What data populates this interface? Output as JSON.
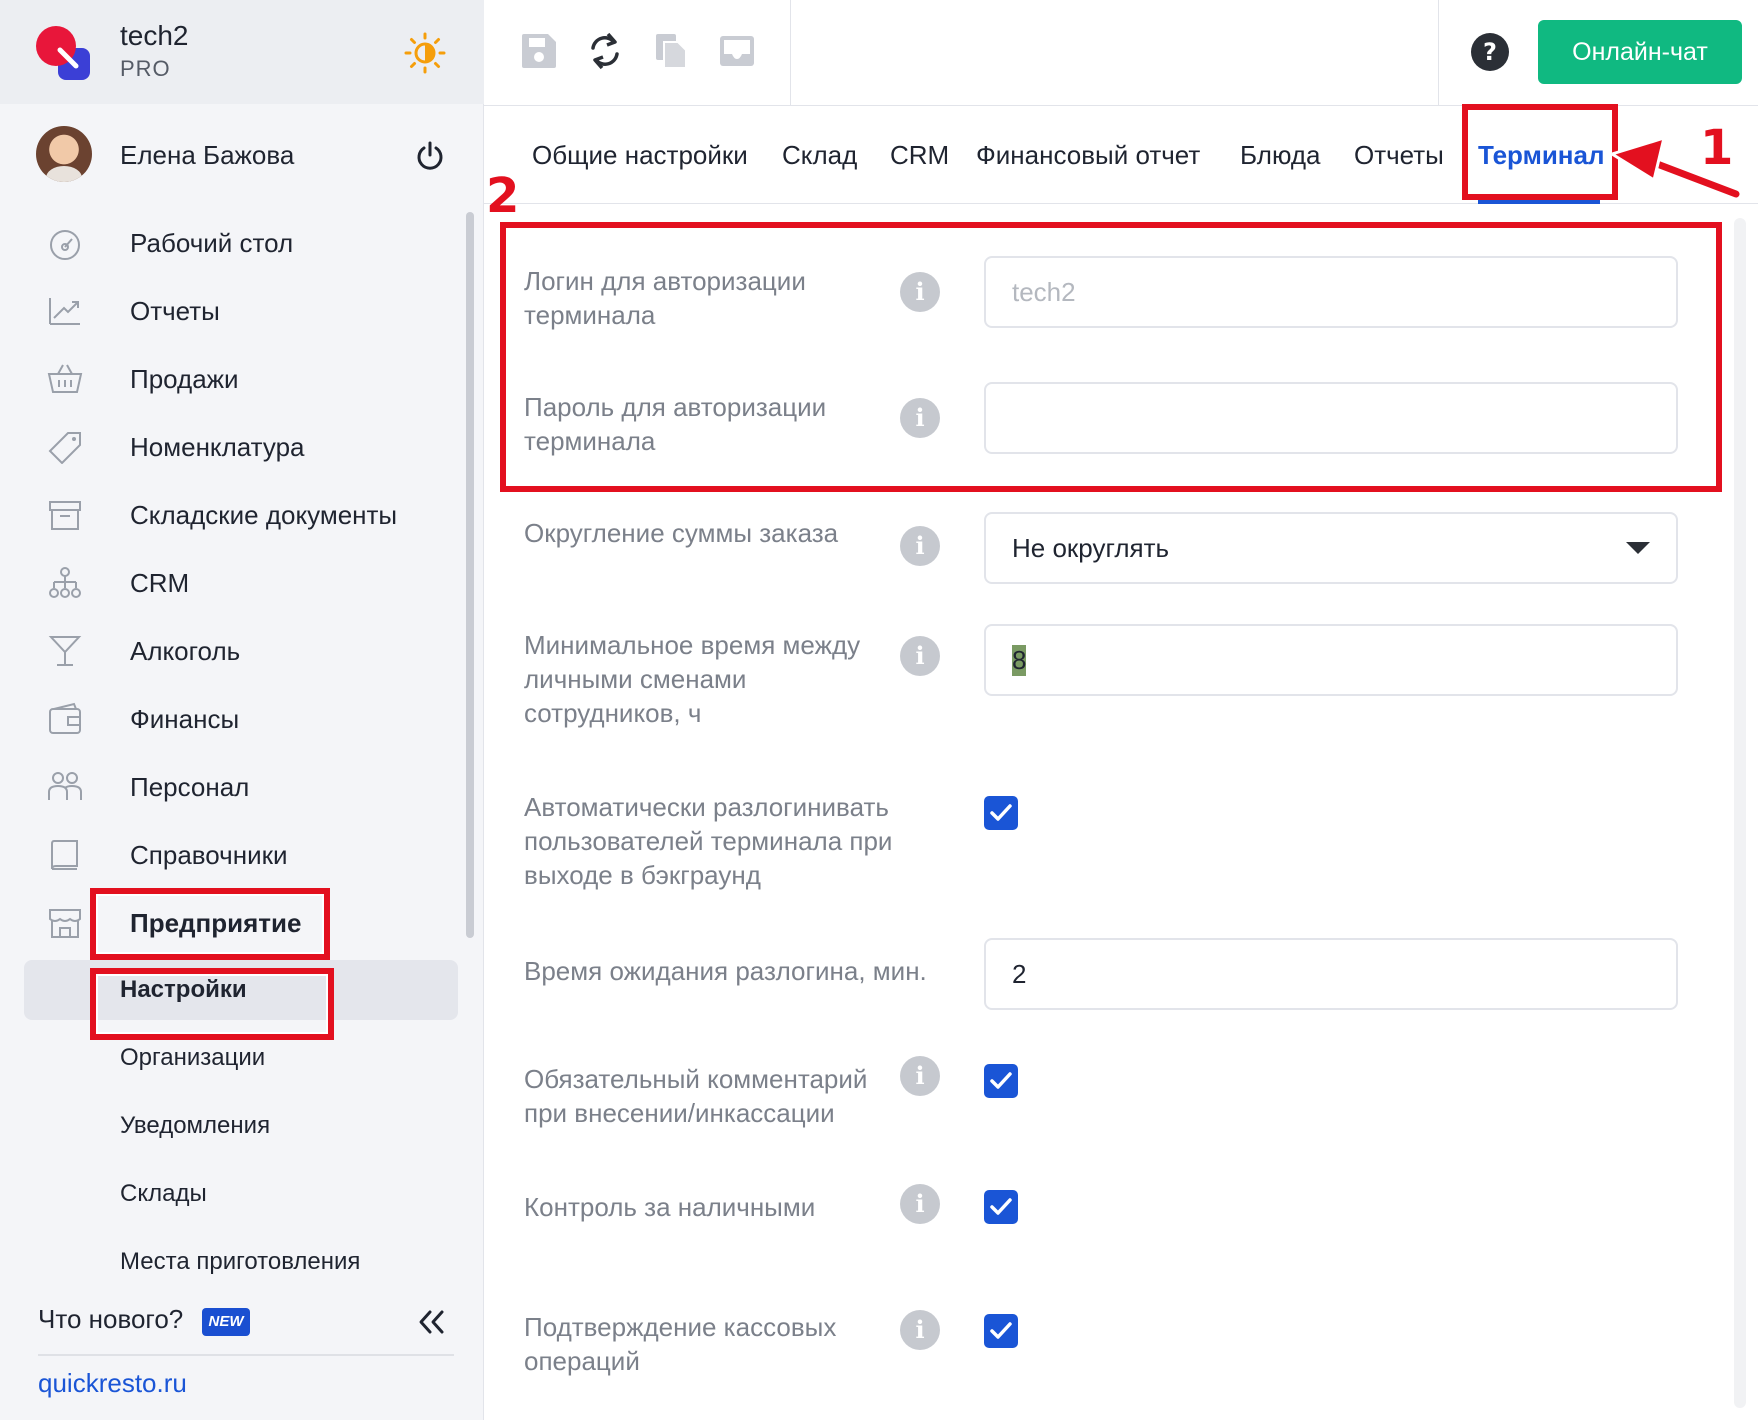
{
  "brand": {
    "name": "tech2",
    "plan": "PRO"
  },
  "user": {
    "name": "Елена Бажова"
  },
  "nav": {
    "items": [
      {
        "label": "Рабочий стол",
        "icon": "dashboard-icon"
      },
      {
        "label": "Отчеты",
        "icon": "chart-up-icon"
      },
      {
        "label": "Продажи",
        "icon": "basket-icon"
      },
      {
        "label": "Номенклатура",
        "icon": "tag-icon"
      },
      {
        "label": "Складские документы",
        "icon": "archive-icon"
      },
      {
        "label": "CRM",
        "icon": "org-chart-icon"
      },
      {
        "label": "Алкоголь",
        "icon": "cocktail-icon"
      },
      {
        "label": "Финансы",
        "icon": "wallet-icon"
      },
      {
        "label": "Персонал",
        "icon": "people-icon"
      },
      {
        "label": "Справочники",
        "icon": "book-icon"
      },
      {
        "label": "Предприятие",
        "icon": "store-icon"
      }
    ],
    "sub_items": [
      {
        "label": "Настройки"
      },
      {
        "label": "Организации"
      },
      {
        "label": "Уведомления"
      },
      {
        "label": "Склады"
      },
      {
        "label": "Места приготовления"
      }
    ],
    "whats_new": "Что нового?",
    "new_badge": "NEW",
    "site_link": "quickresto.ru"
  },
  "topbar": {
    "chat_label": "Онлайн-чат"
  },
  "tabs": [
    {
      "label": "Общие настройки"
    },
    {
      "label": "Склад"
    },
    {
      "label": "CRM"
    },
    {
      "label": "Финансовый отчет"
    },
    {
      "label": "Блюда"
    },
    {
      "label": "Отчеты"
    },
    {
      "label": "Терминал"
    }
  ],
  "form": {
    "login_label": "Логин для авторизации терминала",
    "login_placeholder": "tech2",
    "password_label": "Пароль для авторизации терминала",
    "rounding_label": "Округление суммы заказа",
    "rounding_value": "Не округлять",
    "min_time_label": "Минимальное время между личными сменами сотрудников, ч",
    "min_time_value": "8",
    "auto_logout_label": "Автоматически разлогинивать пользователей терминала при выходе в бэкграунд",
    "logout_wait_label": "Время ожидания разлогина, мин.",
    "logout_wait_value": "2",
    "comment_label": "Обязательный комментарий при внесении/инкассации",
    "cash_control_label": "Контроль за наличными",
    "confirm_label": "Подтверждение кассовых операций",
    "info_glyph": "i"
  },
  "annotations": {
    "one": "1",
    "two": "2"
  },
  "colors": {
    "accent": "#1a55d6",
    "chat": "#10b981",
    "annotation": "#e3101f"
  }
}
